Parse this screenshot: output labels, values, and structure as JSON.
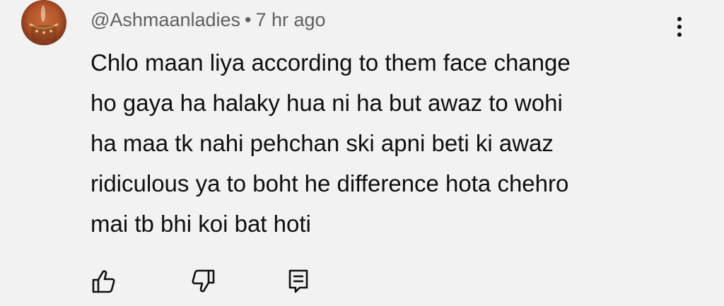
{
  "comment": {
    "author": "@Ashmaanladies",
    "separator": "•",
    "timestamp": "7 hr ago",
    "body_lines": [
      "Chlo maan liya according to them face change",
      "ho gaya ha halaky hua ni ha but awaz to wohi",
      "ha maa tk nahi pehchan ski apni beti ki awaz",
      "ridiculous ya to boht he difference hota chehro",
      "mai tb bhi koi bat hoti"
    ]
  },
  "icons": {
    "avatar": "profile-picture",
    "more": "vertical-ellipsis-icon",
    "like": "thumbs-up-icon",
    "dislike": "thumbs-down-icon",
    "reply": "reply-comment-icon"
  },
  "colors": {
    "background": "#f2f2f2",
    "text_primary": "#0f0f0f",
    "text_secondary": "#606060"
  }
}
